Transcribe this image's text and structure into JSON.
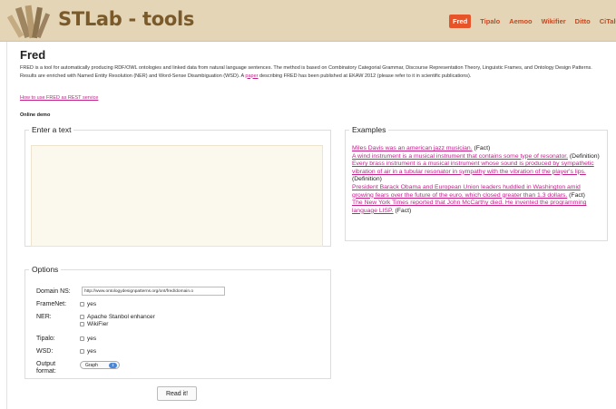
{
  "header": {
    "logo_text": "STLab - tools",
    "nav": [
      "Fred",
      "Tipalo",
      "Aemoo",
      "Wikifier",
      "Ditto",
      "CiTalO"
    ],
    "active_nav": "Fred",
    "colors": {
      "bar": "#e4d5b7",
      "logo_text": "#7a5a2a",
      "nav_link": "#c8471f",
      "nav_active_bg": "#e8542a"
    }
  },
  "page": {
    "title": "Fred",
    "intro_part1": "FRED is a tool for automatically producing RDF/OWL ontologies and linked data from natural language sentences. The method is based on Combinatory Categorial Grammar, Discourse Representation Theory, Linguistic Frames, and Ontology Design Patterns. Results are enriched with Named Entity Resolution (NER) and Word-Sense Disambiguation (WSD). A ",
    "intro_link": "paper",
    "intro_part2": " describing FRED has been published at EKAW 2012 (please refer to it in scientific publications).",
    "rest_link": "How to use FRED as REST service",
    "online_demo": "Online demo",
    "link_color": "#c21f8b"
  },
  "text_panel": {
    "legend": "Enter a text",
    "value": ""
  },
  "examples": {
    "legend": "Examples",
    "items": [
      {
        "text": "Miles Davis was an american jazz musician.",
        "kind": " (Fact)"
      },
      {
        "text": "A wind instrument is a musical instrument that contains some type of resonator.",
        "kind": " (Definition)"
      },
      {
        "text": "Every brass instrument is a musical instrument whose sound is produced by sympathetic vibration of air in a tubular resonator in sympathy with the vibration of the player's lips.",
        "kind": " (Definition)"
      },
      {
        "text": "President Barack Obama and European Union leaders huddled in Washington amid growing fears over the future of the euro, which closed greater than 1.3 dollars.",
        "kind": " (Fact)"
      },
      {
        "text": "The New York Times reported that John McCarthy died. He invented the programming language LISP.",
        "kind": " (Fact)"
      }
    ]
  },
  "options": {
    "legend": "Options",
    "domain_ns_label": "Domain NS:",
    "domain_ns_value": "http://www.ontologydesignpatterns.org/ont/fred/domain.o",
    "framenet_label": "FrameNet:",
    "framenet_option": "yes",
    "ner_label": "NER:",
    "ner_options": [
      "Apache Stanbol enhancer",
      "WikiFier"
    ],
    "tipalo_label": "Tipalo:",
    "tipalo_option": "yes",
    "wsd_label": "WSD:",
    "wsd_option": "yes",
    "output_label_line1": "Output",
    "output_label_line2": "format:",
    "output_value": "Graph",
    "select_arrow_icon": "updown-arrows-icon"
  },
  "submit_label": "Read it!"
}
